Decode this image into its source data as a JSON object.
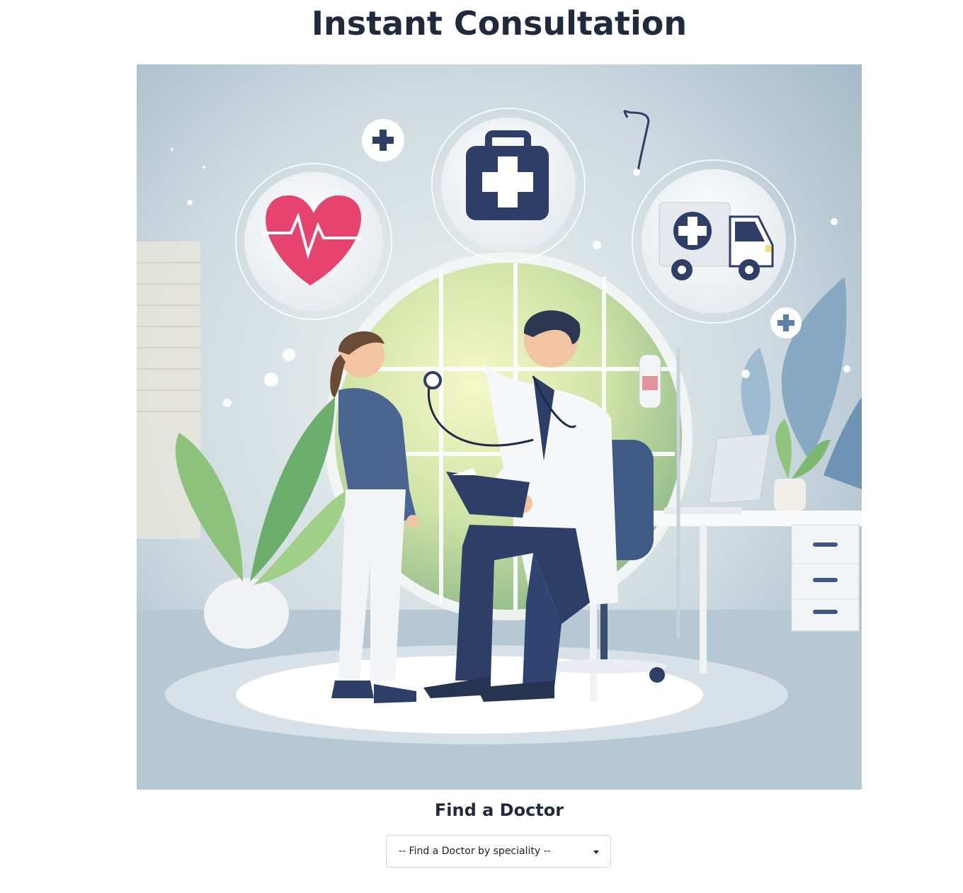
{
  "page": {
    "title": "Instant Consultation"
  },
  "hero": {
    "icons": [
      "plus-icon",
      "heart-pulse-icon",
      "medical-kit-icon",
      "ambulance-icon",
      "stethoscope-icon"
    ],
    "colors": {
      "navy": "#2d3f66",
      "heart": "#e6436f",
      "background": "#b4c6d3",
      "leaf": "#7fbf6b"
    }
  },
  "finder": {
    "title": "Find a Doctor",
    "select": {
      "selected": "-- Find a Doctor by speciality --"
    }
  }
}
